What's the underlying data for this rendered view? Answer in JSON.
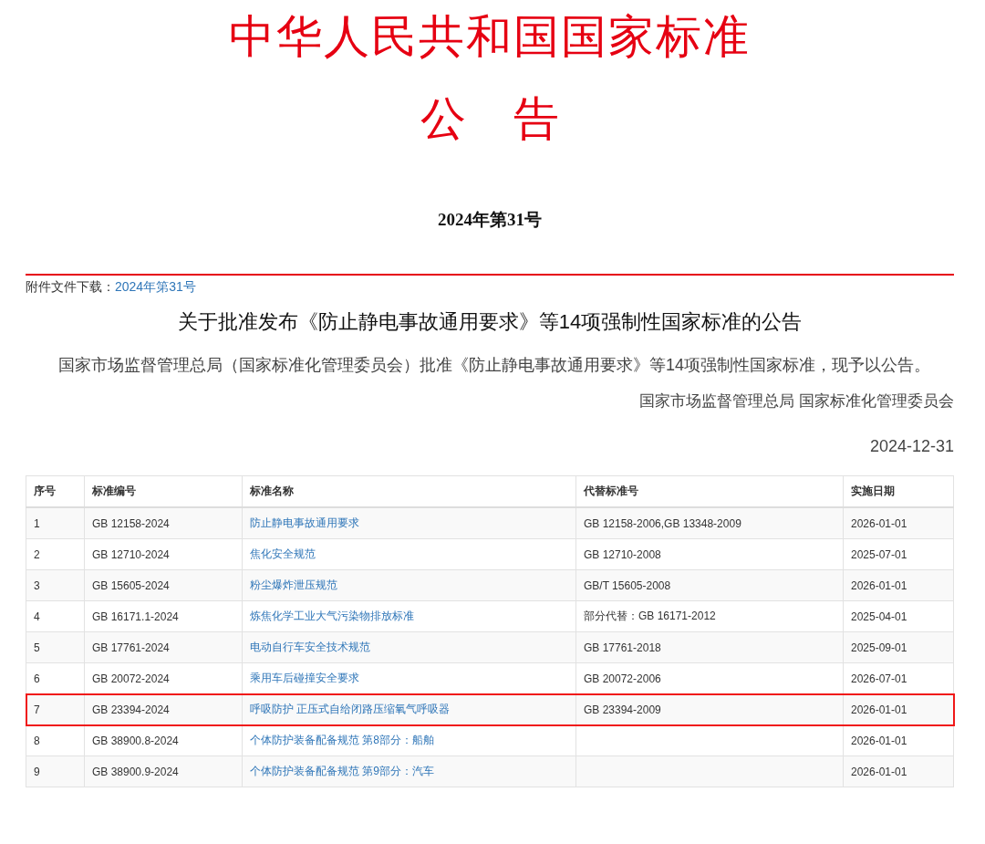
{
  "header": {
    "title": "中华人民共和国国家标准",
    "subtitle": "公 告",
    "number": "2024年第31号"
  },
  "attachment": {
    "label": "附件文件下载：",
    "link": "2024年第31号"
  },
  "article": {
    "heading": "关于批准发布《防止静电事故通用要求》等14项强制性国家标准的公告",
    "body": "国家市场监督管理总局（国家标准化管理委员会）批准《防止静电事故通用要求》等14项强制性国家标准，现予以公告。",
    "signature": "国家市场监督管理总局 国家标准化管理委员会",
    "date": "2024-12-31"
  },
  "table": {
    "columns": [
      "序号",
      "标准编号",
      "标准名称",
      "代替标准号",
      "实施日期"
    ],
    "rows": [
      {
        "no": "1",
        "code": "GB 12158-2024",
        "name": "防止静电事故通用要求",
        "replaces": "GB 12158-2006,GB 13348-2009",
        "date": "2026-01-01",
        "highlighted": false
      },
      {
        "no": "2",
        "code": "GB 12710-2024",
        "name": "焦化安全规范",
        "replaces": "GB 12710-2008",
        "date": "2025-07-01",
        "highlighted": false
      },
      {
        "no": "3",
        "code": "GB 15605-2024",
        "name": "粉尘爆炸泄压规范",
        "replaces": "GB/T 15605-2008",
        "date": "2026-01-01",
        "highlighted": false
      },
      {
        "no": "4",
        "code": "GB 16171.1-2024",
        "name": "炼焦化学工业大气污染物排放标准",
        "replaces": "部分代替：GB 16171-2012",
        "date": "2025-04-01",
        "highlighted": false
      },
      {
        "no": "5",
        "code": "GB 17761-2024",
        "name": "电动自行车安全技术规范",
        "replaces": "GB 17761-2018",
        "date": "2025-09-01",
        "highlighted": false
      },
      {
        "no": "6",
        "code": "GB 20072-2024",
        "name": "乘用车后碰撞安全要求",
        "replaces": "GB 20072-2006",
        "date": "2026-07-01",
        "highlighted": false
      },
      {
        "no": "7",
        "code": "GB 23394-2024",
        "name": "呼吸防护 正压式自给闭路压缩氧气呼吸器",
        "replaces": "GB 23394-2009",
        "date": "2026-01-01",
        "highlighted": true
      },
      {
        "no": "8",
        "code": "GB 38900.8-2024",
        "name": "个体防护装备配备规范 第8部分：船舶",
        "date": "2026-01-01",
        "highlighted": false
      },
      {
        "no": "9",
        "code": "GB 38900.9-2024",
        "name": "个体防护装备配备规范 第9部分：汽车",
        "date": "2026-01-01",
        "highlighted": false
      }
    ]
  }
}
